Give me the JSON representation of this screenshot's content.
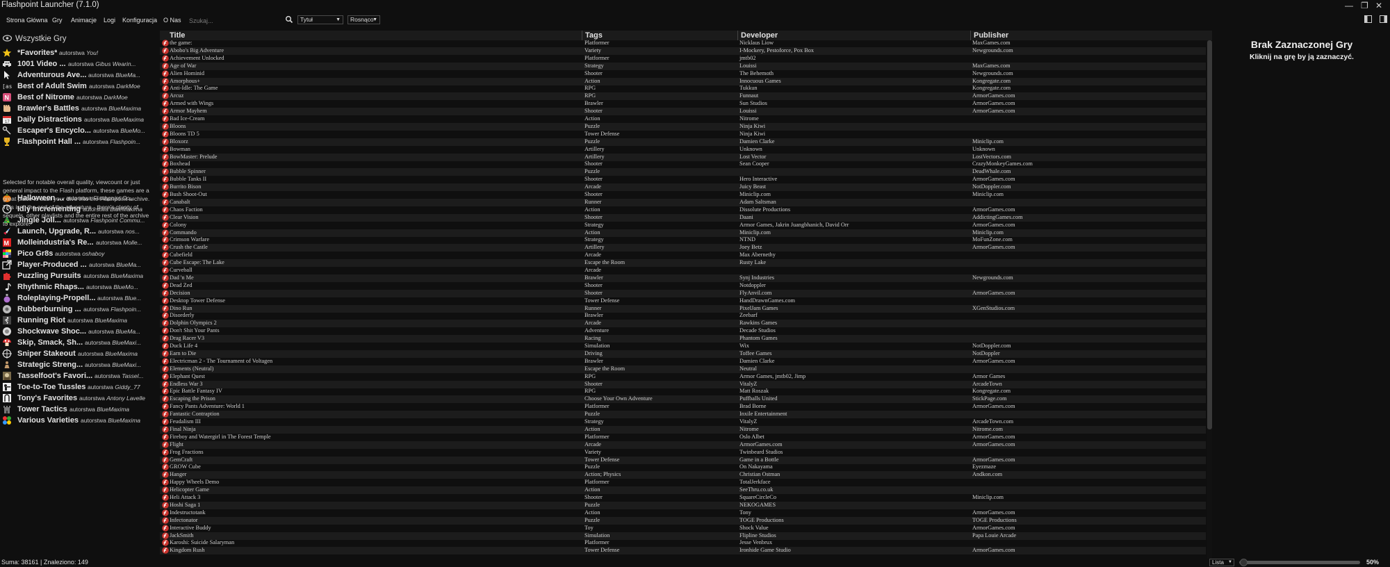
{
  "window": {
    "title": "Flashpoint Launcher (7.1.0)",
    "minimize": "—",
    "maximize": "❐",
    "close": "✕"
  },
  "menu": [
    "Strona Główna",
    "Gry",
    "Animacje",
    "Logi",
    "Konfiguracja",
    "O Nas"
  ],
  "search": {
    "placeholder": "Szukaj...",
    "value": ""
  },
  "sort": {
    "field": "Tytuł",
    "order": "Rosnąco"
  },
  "sidebar": {
    "all_games": "Wszystkie Gry",
    "playlists": [
      {
        "title": "*Favorites*",
        "by": "autorstwa",
        "author": "You!",
        "icon": "star-icon"
      },
      {
        "title": "1001 Video ...",
        "by": "autorstwa",
        "author": "Gibus Wearin...",
        "icon": "space-invader-icon"
      },
      {
        "title": "Adventurous Ave...",
        "by": "autorstwa",
        "author": "BlueMa...",
        "icon": "cursor-icon"
      },
      {
        "title": "Best of Adult Swim",
        "by": "autorstwa",
        "author": "DarkMoe",
        "icon": "adult-swim-icon"
      },
      {
        "title": "Best of Nitrome",
        "by": "autorstwa",
        "author": "DarkMoe",
        "icon": "nitrome-icon"
      },
      {
        "title": "Brawler's Battles",
        "by": "autorstwa",
        "author": "BlueMaxima",
        "icon": "fist-icon"
      },
      {
        "title": "Daily Distractions",
        "by": "autorstwa",
        "author": "BlueMaxima",
        "icon": "calendar-icon"
      },
      {
        "title": "Escaper's Encyclo...",
        "by": "autorstwa",
        "author": "BlueMo...",
        "icon": "key-icon"
      },
      {
        "title": "Flashpoint Hall ...",
        "by": "autorstwa",
        "author": "Flashpoin...",
        "icon": "trophy-icon"
      },
      {
        "title": "Halloween ...",
        "by": "autorstwa",
        "author": "Flashpoint Co...",
        "icon": "pumpkin-icon"
      },
      {
        "title": "Idly Incrementing",
        "by": "autorstwa",
        "author": "BlueMaxima",
        "icon": "clock-icon"
      },
      {
        "title": "Jingle Joll...",
        "by": "autorstwa",
        "author": "Flashpoint Commu...",
        "icon": "christmas-tree-icon"
      },
      {
        "title": "Launch, Upgrade, R...",
        "by": "autorstwa",
        "author": "nos...",
        "icon": "rocket-icon"
      },
      {
        "title": "Molleindustria's Re...",
        "by": "autorstwa",
        "author": "Molle...",
        "icon": "molleindustria-icon"
      },
      {
        "title": "Pico Gr8s",
        "by": "autorstwa",
        "author": "oshaboy",
        "icon": "pico-icon"
      },
      {
        "title": "Player-Produced ...",
        "by": "autorstwa",
        "author": "BlueMa...",
        "icon": "share-icon"
      },
      {
        "title": "Puzzling Pursuits",
        "by": "autorstwa",
        "author": "BlueMaxima",
        "icon": "puzzle-icon"
      },
      {
        "title": "Rhythmic Rhaps...",
        "by": "autorstwa",
        "author": "BlueMo...",
        "icon": "music-note-icon"
      },
      {
        "title": "Roleplaying-Propell...",
        "by": "autorstwa",
        "author": "Blue...",
        "icon": "potion-icon"
      },
      {
        "title": "Rubberburning ...",
        "by": "autorstwa",
        "author": "Flashpoin...",
        "icon": "tire-icon"
      },
      {
        "title": "Running Riot",
        "by": "autorstwa",
        "author": "BlueMaxima",
        "icon": "runner-icon"
      },
      {
        "title": "Shockwave Shoc...",
        "by": "autorstwa",
        "author": "BlueMa...",
        "icon": "shockwave-icon"
      },
      {
        "title": "Skip, Smack, Sh...",
        "by": "autorstwa",
        "author": "BlueMaxi...",
        "icon": "mushroom-icon"
      },
      {
        "title": "Sniper Stakeout",
        "by": "autorstwa",
        "author": "BlueMaxima",
        "icon": "crosshair-icon"
      },
      {
        "title": "Strategic Streng...",
        "by": "autorstwa",
        "author": "BlueMaxi...",
        "icon": "chess-pawn-icon"
      },
      {
        "title": "Tasselfoot's Favori...",
        "by": "autorstwa",
        "author": "Tassel...",
        "icon": "tasselfoot-icon"
      },
      {
        "title": "Toe-to-Toe Tussles",
        "by": "autorstwa",
        "author": "Giddy_77",
        "icon": "fighter-icon"
      },
      {
        "title": "Tony's Favorites",
        "by": "autorstwa",
        "author": "Antony Lavelle",
        "icon": "tony-icon"
      },
      {
        "title": "Tower Tactics",
        "by": "autorstwa",
        "author": "BlueMaxima",
        "icon": "tower-icon"
      },
      {
        "title": "Various Varieties",
        "by": "autorstwa",
        "author": "BlueMaxima",
        "icon": "colorful-dots-icon"
      }
    ],
    "description": "Selected for notable overall quality, viewcount or just general impact to the Flash platform, these games are a great place to start your dive into the Flashpoint archive. This isn't the end of the adventure - there's plenty of sequels, other playlists and the entire rest of the archive to explore."
  },
  "columns": {
    "title": "Title",
    "tags": "Tags",
    "developer": "Developer",
    "publisher": "Publisher"
  },
  "games": [
    [
      "the game:",
      "Platformer",
      "Nicklaus Liow",
      "MaxGames.com"
    ],
    [
      "Abobo's Big Adventure",
      "Variety",
      "I-Mockery, Pestoforce, Pox Box",
      "Newgrounds.com"
    ],
    [
      "Achievement Unlocked",
      "Platformer",
      "jmtb02",
      ""
    ],
    [
      "Age of War",
      "Strategy",
      "Louissi",
      "MaxGames.com"
    ],
    [
      "Alien Hominid",
      "Shooter",
      "The Behemoth",
      "Newgrounds.com"
    ],
    [
      "Amorphous+",
      "Action",
      "Innocuous Games",
      "Kongregate.com"
    ],
    [
      "Anti-Idle: The Game",
      "RPG",
      "Tukkun",
      "Kongregate.com"
    ],
    [
      "Arcuz",
      "RPG",
      "Funnaut",
      "ArmorGames.com"
    ],
    [
      "Armed with Wings",
      "Brawler",
      "Sun Studios",
      "ArmorGames.com"
    ],
    [
      "Armor Mayhem",
      "Shooter",
      "Louissi",
      "ArmorGames.com"
    ],
    [
      "Bad Ice-Cream",
      "Action",
      "Nitrome",
      ""
    ],
    [
      "Bloons",
      "Puzzle",
      "Ninja Kiwi",
      ""
    ],
    [
      "Bloons TD 5",
      "Tower Defense",
      "Ninja Kiwi",
      ""
    ],
    [
      "Bloxorz",
      "Puzzle",
      "Damien Clarke",
      "Miniclip.com"
    ],
    [
      "Bowman",
      "Artillery",
      "Unknown",
      "Unknown"
    ],
    [
      "BowMaster: Prelude",
      "Artillery",
      "Lost Vector",
      "LostVectors.com"
    ],
    [
      "Boxhead",
      "Shooter",
      "Sean Cooper",
      "CrazyMonkeyGames.com"
    ],
    [
      "Bubble Spinner",
      "Puzzle",
      "",
      "DeadWhale.com"
    ],
    [
      "Bubble Tanks II",
      "Shooter",
      "Hero Interactive",
      "ArmorGames.com"
    ],
    [
      "Burrito Bison",
      "Arcade",
      "Juicy Beast",
      "NotDoppler.com"
    ],
    [
      "Bush Shoot-Out",
      "Shooter",
      "Miniclip.com",
      "Miniclip.com"
    ],
    [
      "Canabalt",
      "Runner",
      "Adam Saltsman",
      ""
    ],
    [
      "Chaos Faction",
      "Action",
      "Dissolute Productions",
      "ArmorGames.com"
    ],
    [
      "Clear Vision",
      "Shooter",
      "Daani",
      "AddictingGames.com"
    ],
    [
      "Colony",
      "Strategy",
      "Armor Games, Jakrin Juangbhanich, David Orr",
      "ArmorGames.com"
    ],
    [
      "Commando",
      "Action",
      "Miniclip.com",
      "Miniclip.com"
    ],
    [
      "Crimson Warfare",
      "Strategy",
      "NTND",
      "MoFunZone.com"
    ],
    [
      "Crush the Castle",
      "Artillery",
      "Joey Betz",
      "ArmorGames.com"
    ],
    [
      "Cubefield",
      "Arcade",
      "Max Abernethy",
      ""
    ],
    [
      "Cube Escape: The Lake",
      "Escape the Room",
      "Rusty Lake",
      ""
    ],
    [
      "Curveball",
      "Arcade",
      "",
      ""
    ],
    [
      "Dad 'n Me",
      "Brawler",
      "Synj Industries",
      "Newgrounds.com"
    ],
    [
      "Dead Zed",
      "Shooter",
      "Notdoppler",
      ""
    ],
    [
      "Decision",
      "Shooter",
      "FlyAnvil.com",
      "ArmorGames.com"
    ],
    [
      "Desktop Tower Defense",
      "Tower Defense",
      "HandDrawnGames.com",
      ""
    ],
    [
      "Dino Run",
      "Runner",
      "PixelJam Games",
      "XGenStudios.com"
    ],
    [
      "Disorderly",
      "Brawler",
      "Zeebarf",
      ""
    ],
    [
      "Dolphin Olympics 2",
      "Arcade",
      "Rawkins Games",
      ""
    ],
    [
      "Don't Shit Your Pants",
      "Adventure",
      "Decade Studios",
      ""
    ],
    [
      "Drag Racer V3",
      "Racing",
      "Phantom Games",
      ""
    ],
    [
      "Duck Life 4",
      "Simulation",
      "Wix",
      "NotDoppler.com"
    ],
    [
      "Earn to Die",
      "Driving",
      "Toffee Games",
      "NotDoppler"
    ],
    [
      "Electricman 2 - The Tournament of Voltagen",
      "Brawler",
      "Damien Clarke",
      "ArmorGames.com"
    ],
    [
      "Elements (Neutral)",
      "Escape the Room",
      "Neutral",
      ""
    ],
    [
      "Elephant Quest",
      "RPG",
      "Armor Games, jmtb02, Jimp",
      "Armor Games"
    ],
    [
      "Endless War 3",
      "Shooter",
      "VitalyZ",
      "ArcadeTown"
    ],
    [
      "Epic Battle Fantasy IV",
      "RPG",
      "Matt Roszak",
      "Kongregate.com"
    ],
    [
      "Escaping the Prison",
      "Choose Your Own Adventure",
      "Puffballs United",
      "StickPage.com"
    ],
    [
      "Fancy Pants Adventure: World 1",
      "Platformer",
      "Brad Borne",
      "ArmorGames.com"
    ],
    [
      "Fantastic Contraption",
      "Puzzle",
      "Inxile Entertainment",
      ""
    ],
    [
      "Feudalism III",
      "Strategy",
      "VitalyZ",
      "ArcadeTown.com"
    ],
    [
      "Final Ninja",
      "Action",
      "Nitrome",
      "Nitrome.com"
    ],
    [
      "Fireboy and Watergirl in The Forest Temple",
      "Platformer",
      "Oslo Albet",
      "ArmorGames.com"
    ],
    [
      "Flight",
      "Arcade",
      "ArmorGames.com",
      "ArmorGames.com"
    ],
    [
      "Frog Fractions",
      "Variety",
      "Twinbeard Studios",
      ""
    ],
    [
      "GemCraft",
      "Tower Defense",
      "Game in a Bottle",
      "ArmorGames.com"
    ],
    [
      "GROW Cube",
      "Puzzle",
      "On Nakayama",
      "Eyezmaze"
    ],
    [
      "Hanger",
      "Action; Physics",
      "Christian Ostman",
      "Andkon.com"
    ],
    [
      "Happy Wheels Demo",
      "Platformer",
      "TotalJerkface",
      ""
    ],
    [
      "Helicopter Game",
      "Action",
      "SeeThru.co.uk",
      ""
    ],
    [
      "Heli Attack 3",
      "Shooter",
      "SquareCircleCo",
      "Miniclip.com"
    ],
    [
      "Hoshi Saga 1",
      "Puzzle",
      "NEKOGAMES",
      ""
    ],
    [
      "Indestructotank",
      "Action",
      "Tony",
      "ArmorGames.com"
    ],
    [
      "Infectonator",
      "Puzzle",
      "TOGE Productions",
      "TOGE Productions"
    ],
    [
      "Interactive Buddy",
      "Toy",
      "Shock Value",
      "ArmorGames.com"
    ],
    [
      "JackSmith",
      "Simulation",
      "Flipline Studios",
      "Papa Louie Arcade"
    ],
    [
      "Karoshi: Suicide Salaryman",
      "Platformer",
      "Jesse Venbrux",
      ""
    ],
    [
      "Kingdom Rush",
      "Tower Defense",
      "Ironhide Game Studio",
      "ArmorGames.com"
    ]
  ],
  "right_panel": {
    "title": "Brak Zaznaczonej Gry",
    "subtitle": "Kliknij na grę by ją zaznaczyć."
  },
  "footer": {
    "status": "Suma: 38161 | Znaleziono: 149",
    "view": "Lista",
    "zoom_label": "50%",
    "zoom_fraction": 0.02
  }
}
